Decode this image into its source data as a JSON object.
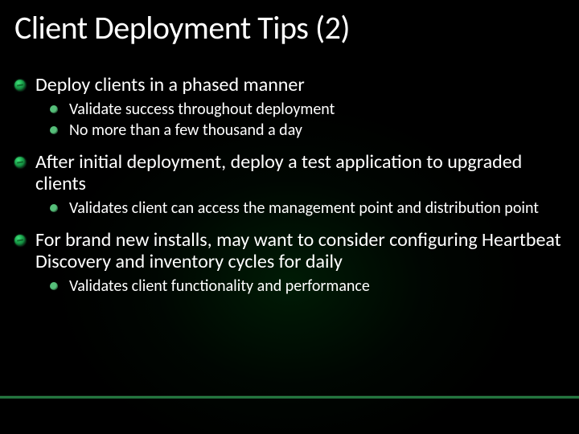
{
  "title": "Client Deployment Tips (2)",
  "accent_color": "#2b8a4a",
  "items": [
    {
      "text": "Deploy clients in a phased manner",
      "subs": [
        {
          "text": "Validate success throughout deployment"
        },
        {
          "text": "No more than a few thousand a day"
        }
      ]
    },
    {
      "text": "After initial deployment, deploy a test application to upgraded clients",
      "subs": [
        {
          "text": "Validates client can access the management point and distribution point"
        }
      ]
    },
    {
      "text": "For brand new installs, may want to consider configuring Heartbeat Discovery and inventory cycles for daily",
      "subs": [
        {
          "text": "Validates client functionality and performance"
        }
      ]
    }
  ]
}
